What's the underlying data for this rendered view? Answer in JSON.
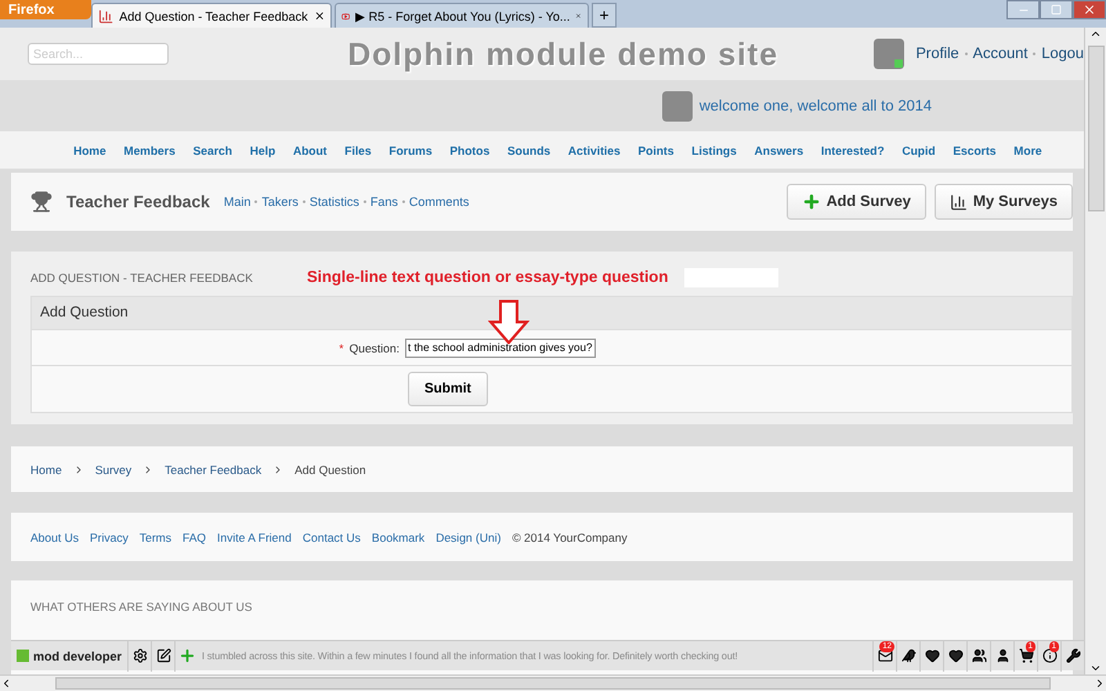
{
  "browser": {
    "menu_button": "Firefox",
    "tabs": [
      {
        "title": "Add Question - Teacher Feedback",
        "selected": true,
        "kind": "page"
      },
      {
        "title": "▶ R5 - Forget About You (Lyrics) - Yo...",
        "selected": false,
        "kind": "video"
      }
    ],
    "new_tab": "+"
  },
  "header": {
    "search": {
      "placeholder": "Search..."
    },
    "site_title": "Dolphin module demo site",
    "user_links": [
      "Profile",
      "Account",
      "Logou"
    ]
  },
  "welcome": "welcome one, welcome all to 2014",
  "nav": [
    "Home",
    "Members",
    "Search",
    "Help",
    "About",
    "Files",
    "Forums",
    "Photos",
    "Sounds",
    "Activities",
    "Points",
    "Listings",
    "Answers",
    "Interested?",
    "Cupid",
    "Escorts",
    "More"
  ],
  "module": {
    "title": "Teacher Feedback",
    "links": [
      "Main",
      "Takers",
      "Statistics",
      "Fans",
      "Comments"
    ],
    "buttons": [
      {
        "label": "Add Survey",
        "kind": "add"
      },
      {
        "label": "My Surveys",
        "kind": "chart"
      }
    ]
  },
  "form_section": {
    "heading": "ADD QUESTION - TEACHER FEEDBACK",
    "annotation": "Single-line text question or essay-type question",
    "panel_title": "Add Question",
    "field_label": "Question:",
    "required_mark": "*",
    "field_value": "t the school administration gives you?",
    "submit": "Submit"
  },
  "breadcrumb": [
    {
      "label": "Home",
      "link": true
    },
    {
      "label": "Survey",
      "link": true
    },
    {
      "label": "Teacher Feedback",
      "link": true
    },
    {
      "label": "Add Question",
      "link": false
    }
  ],
  "footer": {
    "links": [
      "About Us",
      "Privacy",
      "Terms",
      "FAQ",
      "Invite A Friend",
      "Contact Us",
      "Bookmark",
      "Design (Uni)"
    ],
    "copyright": "© 2014 YourCompany"
  },
  "testimonials": {
    "heading": "WHAT OTHERS ARE SAYING ABOUT US",
    "text": "I stumbled across this site. Within a few minutes I found all the information that I was looking for. Definitely worth checking out!"
  },
  "toolbar": {
    "user": "mod developer",
    "online": true,
    "right_icons": [
      {
        "kind": "mail",
        "badge": "12"
      },
      {
        "kind": "bird"
      },
      {
        "kind": "heart"
      },
      {
        "kind": "heart"
      },
      {
        "kind": "group"
      },
      {
        "kind": "person"
      },
      {
        "kind": "cart",
        "badge": "1"
      },
      {
        "kind": "info",
        "badge": "1"
      },
      {
        "kind": "wrench"
      }
    ]
  }
}
